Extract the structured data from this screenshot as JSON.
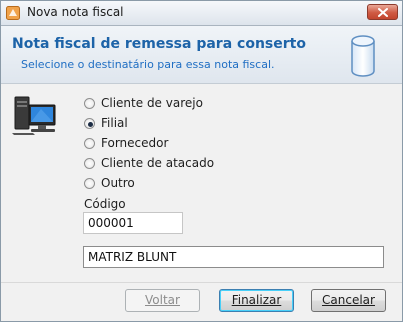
{
  "window": {
    "title": "Nova nota fiscal"
  },
  "header": {
    "title": "Nota fiscal de remessa para conserto",
    "subtitle": "Selecione o destinatário para essa nota fiscal."
  },
  "form": {
    "options": [
      {
        "label": "Cliente de varejo",
        "selected": false
      },
      {
        "label": "Filial",
        "selected": true
      },
      {
        "label": "Fornecedor",
        "selected": false
      },
      {
        "label": "Cliente de atacado",
        "selected": false
      },
      {
        "label": "Outro",
        "selected": false
      }
    ],
    "codigo_label": "Código",
    "codigo_value": "000001",
    "name_value": "MATRIZ BLUNT"
  },
  "buttons": {
    "voltar": "Voltar",
    "finalizar": "Finalizar",
    "cancelar": "Cancelar"
  },
  "colors": {
    "header_title": "#1d63a8",
    "header_subtitle": "#1f6ec3",
    "close_button": "#c9523c"
  }
}
